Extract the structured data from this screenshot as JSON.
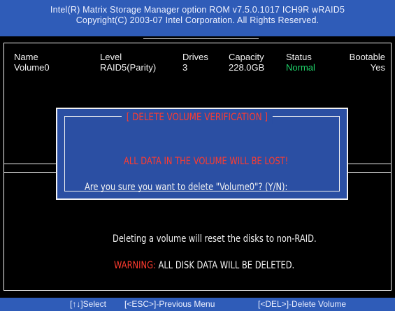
{
  "header": {
    "line1": "Intel(R) Matrix Storage Manager option ROM v7.5.0.1017 ICH9R wRAID5",
    "line2": "Copyright(C) 2003-07 Intel Corporation. All Rights Reserved."
  },
  "volume_table": {
    "columns": [
      "Name",
      "Level",
      "Drives",
      "Capacity",
      "Status",
      "Bootable"
    ],
    "rows": [
      [
        "Volume0",
        "RAID5(Parity)",
        "3",
        "228.0GB",
        "Normal",
        "Yes"
      ]
    ]
  },
  "dialog": {
    "title": "[ DELETE VOLUME VERIFICATION ]",
    "warning": "ALL DATA IN THE VOLUME WILL BE LOST!",
    "prompt": "Are you sure you want to delete \"Volume0\"? (Y/N):"
  },
  "info": {
    "line1": "Deleting a volume will reset the disks to non-RAID.",
    "warning_label": "WARNING:",
    "warning_text": " ALL DISK DATA WILL BE DELETED."
  },
  "footer": {
    "select": "[↑↓]Select",
    "esc": "[<ESC>]-Previous Menu",
    "del": "[<DEL>]-Delete Volume"
  },
  "colors": {
    "background": "#2b4fa3",
    "title_bar": "#2f5cb8",
    "status_normal": "#1fd46a",
    "warning": "#ff3b2f"
  }
}
